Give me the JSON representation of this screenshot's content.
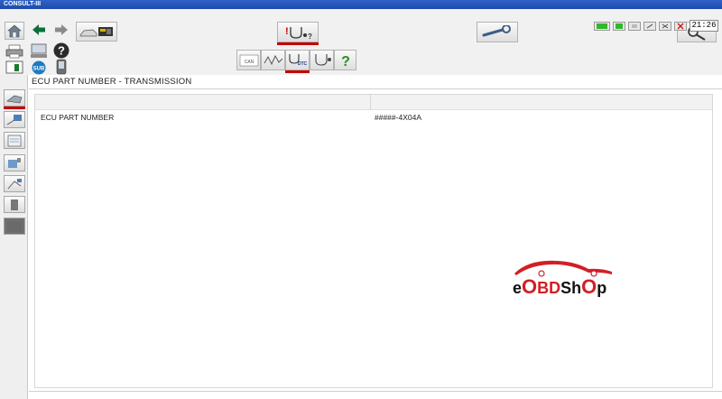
{
  "window": {
    "title": "CONSULT-III"
  },
  "header": {
    "title": "ECU PART NUMBER - TRANSMISSION"
  },
  "table": {
    "rows": [
      {
        "label": "ECU PART NUMBER",
        "value": "#####-4X04A"
      }
    ]
  },
  "status": {
    "clock": "21:26"
  },
  "toolbar": {
    "mode_icons": [
      "can-icon",
      "waveform-icon",
      "dtc-stethoscope-icon",
      "stethoscope-icon",
      "help-icon"
    ],
    "dtc_label": "DTC"
  },
  "logo": {
    "text": "eOBDShOp"
  },
  "colors": {
    "accent_red": "#c40000",
    "titlebar": "#2f63c9",
    "toolbar_bg": "#f1f1f1"
  }
}
